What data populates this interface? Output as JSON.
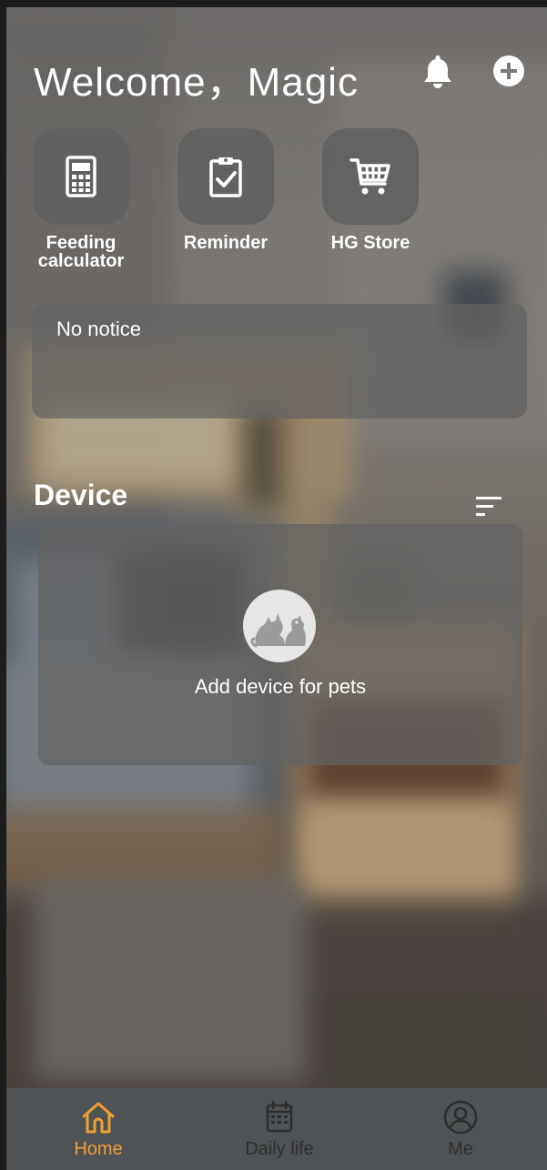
{
  "header": {
    "welcome_text": "Welcome，Magic"
  },
  "shortcuts": [
    {
      "label": "Feeding calculator",
      "icon": "calculator-icon"
    },
    {
      "label": "Reminder",
      "icon": "clipboard-check-icon"
    },
    {
      "label": "HG Store",
      "icon": "shopping-cart-icon"
    }
  ],
  "notice": {
    "text": "No notice"
  },
  "device_section": {
    "title": "Device",
    "empty_text": "Add device for pets"
  },
  "tabbar": {
    "items": [
      {
        "label": "Home",
        "icon": "home-icon",
        "active": true
      },
      {
        "label": "Daily life",
        "icon": "calendar-icon",
        "active": false
      },
      {
        "label": "Me",
        "icon": "user-icon",
        "active": false
      }
    ]
  },
  "colors": {
    "accent": "#f0a030",
    "tabbar_bg": "#505356",
    "card_bg": "#626262",
    "inactive_tab": "#2e2e2e"
  }
}
